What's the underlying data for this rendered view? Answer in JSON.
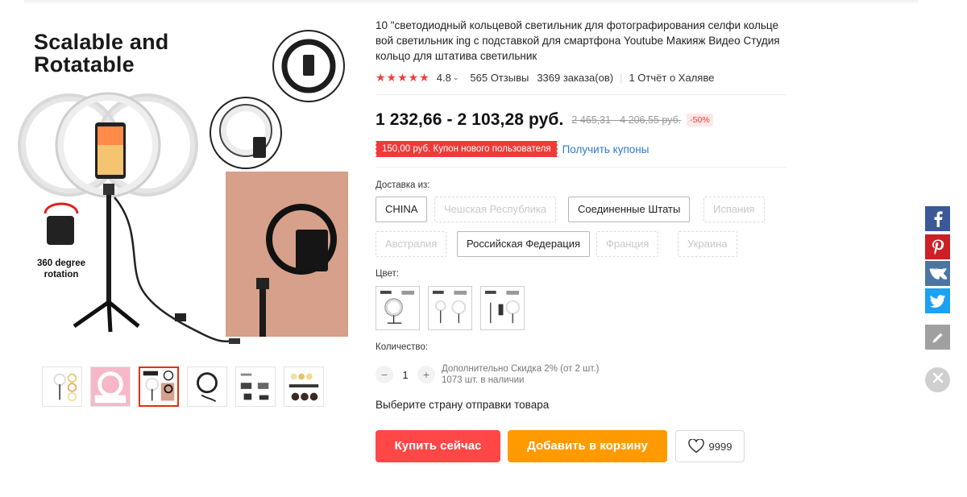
{
  "gallery": {
    "main_image_title": "Scalable and\nRotatable",
    "main_image_rotation_caption": "360 degree\nrotation"
  },
  "product": {
    "title": "10 \"светодиодный кольцевой светильник для фотографирования селфи кольце вой светильник ing с подставкой для смартфона Youtube Макияж Видео Студия кольцо для штатива светильник",
    "stars": "★★★★★",
    "rating": "4.8",
    "reviews": "565 Отзывы",
    "orders": "3369 заказа(ов)",
    "freebie_report": "1 Отчёт о Халяве"
  },
  "price": {
    "current": "1 232,66 - 2 103,28 руб.",
    "old": "2 465,31 - 4 206,55 руб.",
    "discount": "-50%"
  },
  "coupon": {
    "badge": "150,00 руб. Купон нового пользователя",
    "link": "Получить купоны"
  },
  "shipping": {
    "label": "Доставка из:",
    "options": [
      {
        "label": "CHINA",
        "enabled": true
      },
      {
        "label": "Чешская Республика",
        "enabled": false
      },
      {
        "label": "Соединенные Штаты",
        "enabled": true
      },
      {
        "label": "Испания",
        "enabled": false
      },
      {
        "label": "Австралия",
        "enabled": false
      },
      {
        "label": "Российская Федерация",
        "enabled": true
      },
      {
        "label": "Франция",
        "enabled": false
      },
      {
        "label": "Украина",
        "enabled": false
      }
    ]
  },
  "color": {
    "label": "Цвет:"
  },
  "quantity": {
    "label": "Количество:",
    "minus": "−",
    "value": "1",
    "plus": "+",
    "discount_note": "Дополнительно Скидка 2% (от 2 шт.)",
    "stock_note": "1073 шт. в наличии"
  },
  "ship_prompt": "Выберите страну отправки товара",
  "actions": {
    "buy_now": "Купить сейчас",
    "add_to_cart": "Добавить в корзину",
    "wishlist_count": "9999"
  },
  "colors": {
    "buy": "#ff4747",
    "cart": "#ff9a00",
    "stars": "#f04040",
    "link": "#2e7bd0",
    "facebook": "#3b5998",
    "pinterest": "#cb2027",
    "vk": "#4c75a3",
    "twitter": "#1da1f2"
  },
  "icons": [
    "heart-icon",
    "facebook-icon",
    "pinterest-icon",
    "vk-icon",
    "twitter-icon",
    "pencil-icon",
    "close-icon"
  ]
}
